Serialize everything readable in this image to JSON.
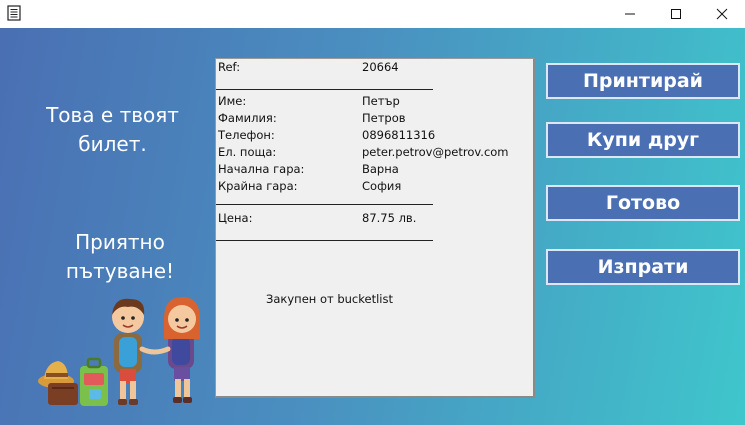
{
  "window": {
    "controls": [
      "minimize-icon",
      "maximize-icon",
      "close-icon"
    ]
  },
  "left": {
    "message_1": "Това е твоят билет.",
    "message_2": "Приятно пътуване!"
  },
  "ticket": {
    "ref_label": "Ref:",
    "ref_value": "20664",
    "fields": [
      {
        "label": "Име:",
        "value": "Петър"
      },
      {
        "label": "Фамилия:",
        "value": "Петров"
      },
      {
        "label": "Телефон:",
        "value": "0896811316"
      },
      {
        "label": "Ел. поща:",
        "value": "peter.petrov@petrov.com"
      },
      {
        "label": "Начална гара:",
        "value": "Варна"
      },
      {
        "label": "Крайна гара:",
        "value": "София"
      }
    ],
    "price_label": "Цена:",
    "price_value": "87.75 лв.",
    "bought_by": "Закупен от bucketlist"
  },
  "buttons": {
    "print": "Принтирай",
    "buy_another": "Купи друг",
    "done": "Готово",
    "send": "Изпрати"
  },
  "colors": {
    "button_bg": "#4a6fb3",
    "gradient_start": "#4a6fb3",
    "gradient_end": "#3fc6cc"
  }
}
